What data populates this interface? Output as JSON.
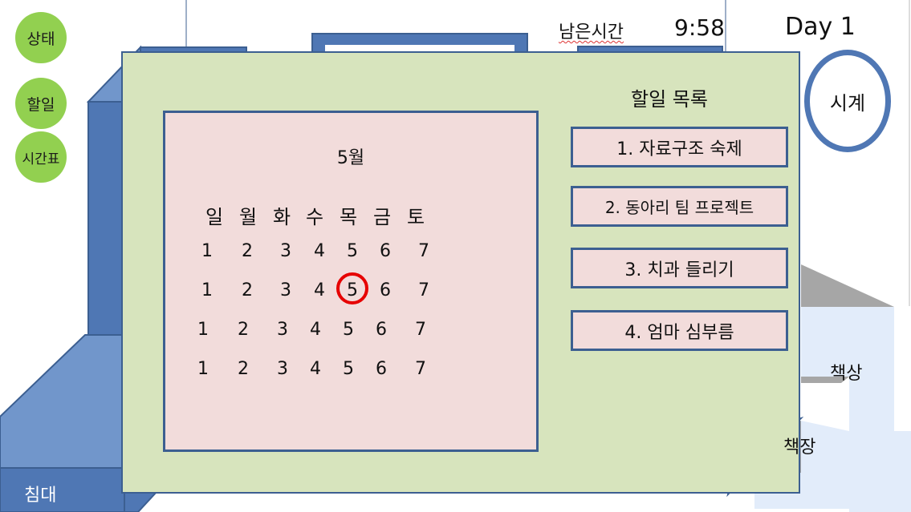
{
  "menu": {
    "status": "상태",
    "todo": "할일",
    "timetable": "시간표"
  },
  "hud": {
    "remain_label": "남은시간",
    "remain_time": "9:58",
    "day": "Day 1",
    "clock": "시계"
  },
  "calendar": {
    "title": "5월",
    "weekdays": [
      "일",
      "월",
      "화",
      "수",
      "목",
      "금",
      "토"
    ],
    "rows": [
      [
        "1",
        "2",
        "3",
        "4",
        "5",
        "6",
        "7"
      ],
      [
        "1",
        "2",
        "3",
        "4",
        "5",
        "6",
        "7"
      ],
      [
        "1",
        "2",
        "3",
        "4",
        "5",
        "6",
        "7"
      ],
      [
        "1",
        "2",
        "3",
        "4",
        "5",
        "6",
        "7"
      ]
    ],
    "highlight": {
      "row": 1,
      "col": 4
    },
    "highlight_color": "#e60000"
  },
  "todo": {
    "title": "할일 목록",
    "items": [
      "1. 자료구조 숙제",
      "2. 동아리 팀 프로젝트",
      "3. 치과 들리기",
      "4. 엄마 심부름"
    ]
  },
  "room": {
    "bed": "침대",
    "desk": "책상",
    "shelf": "책장"
  },
  "colors": {
    "menu_button": "#92d050",
    "note_bg": "#d7e4bd",
    "card_bg": "#f2dcdb",
    "border_blue": "#3c5f91",
    "furniture_blue": "#4f77b4"
  }
}
